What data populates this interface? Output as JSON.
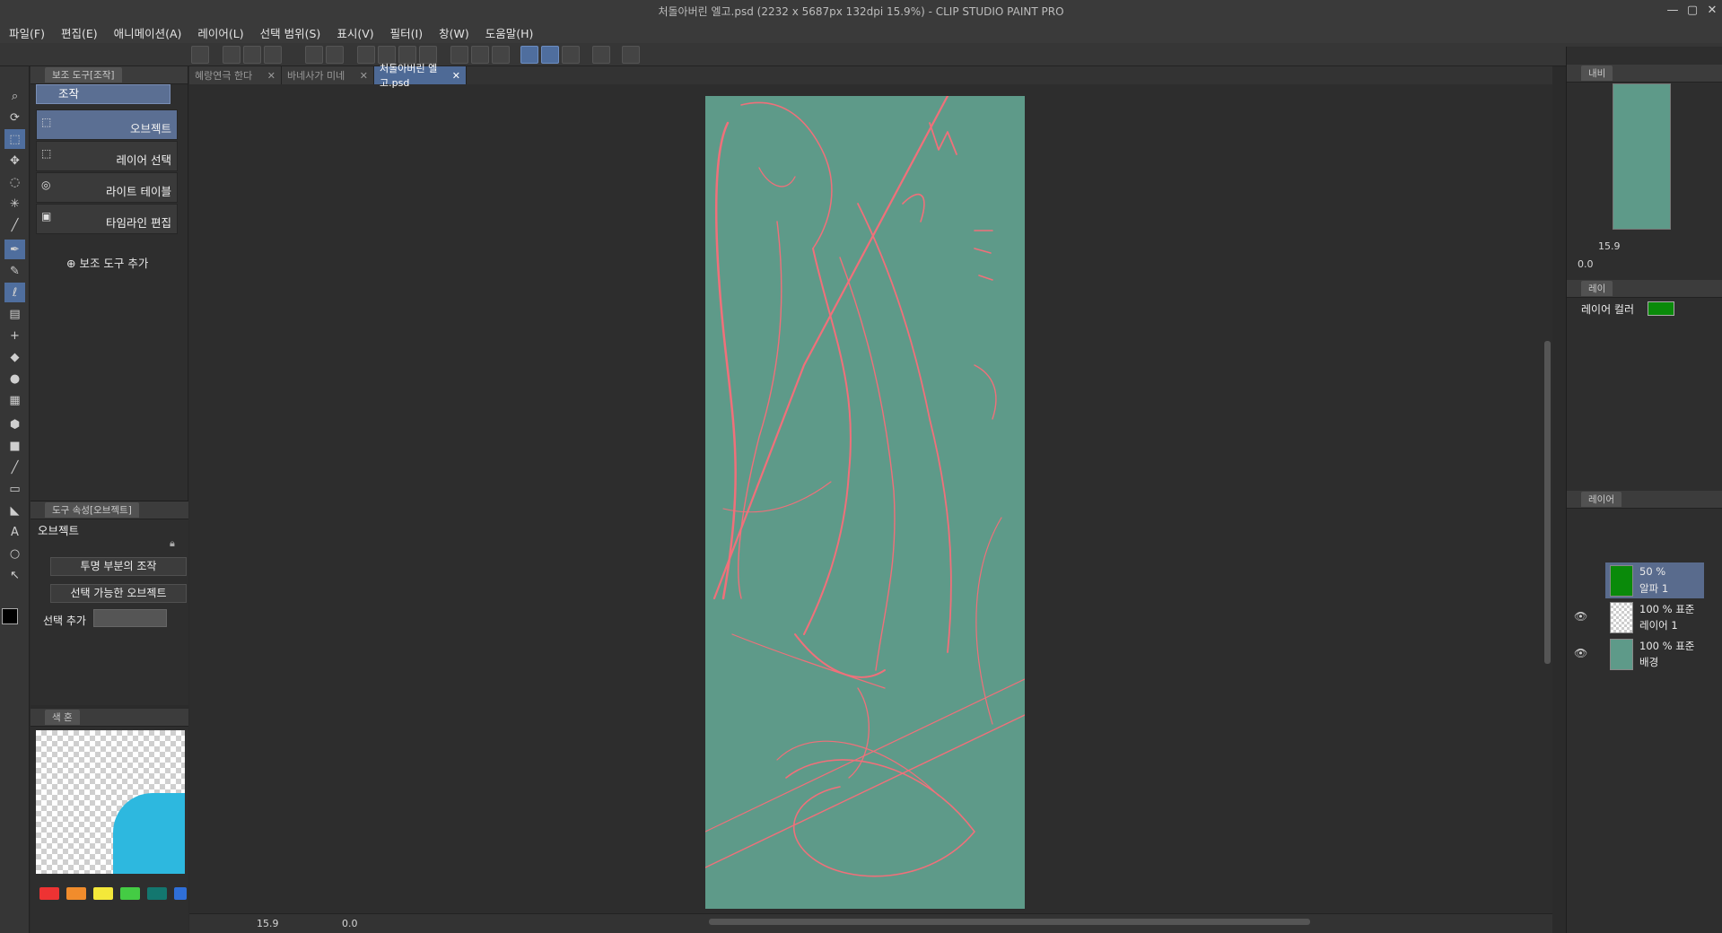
{
  "window": {
    "title": "처돌아버린 엘고.psd (2232 x 5687px 132dpi 15.9%)  - CLIP STUDIO PAINT PRO",
    "controls": [
      "—",
      "▢",
      "✕"
    ]
  },
  "menu": [
    "파일(F)",
    "편집(E)",
    "애니메이션(A)",
    "레이어(L)",
    "선택 범위(S)",
    "표시(V)",
    "필터(I)",
    "창(W)",
    "도움말(H)"
  ],
  "subtool_panel": {
    "title": "보조 도구[조작]",
    "group": "조작",
    "items": [
      {
        "label": "오브젝트",
        "icon": "object-icon",
        "selected": true
      },
      {
        "label": "레이어 선택",
        "icon": "layer-select-icon",
        "selected": false
      },
      {
        "label": "라이트 테이블",
        "icon": "light-table-icon",
        "selected": false
      },
      {
        "label": "타임라인 편집",
        "icon": "timeline-icon",
        "selected": false
      }
    ],
    "add_label": "보조 도구 추가"
  },
  "tool_property": {
    "title": "도구 속성[오브젝트]",
    "heading": "오브젝트",
    "transparent_op": "투명 부분의 조작",
    "selectable": "선택 가능한 오브젝트",
    "add_select_label": "선택 추가"
  },
  "color_panel": {
    "tab": "색 혼",
    "swatches": [
      "#ee3333",
      "#f18c2c",
      "#f4e83a",
      "#44cc44",
      "#13776f",
      "#2f6fd8"
    ]
  },
  "doc_tabs": [
    {
      "label": "혜랑연극 한다",
      "active": false
    },
    {
      "label": "바네사가 미네",
      "active": false
    },
    {
      "label": "처돌아버린 엘고.psd",
      "active": true
    }
  ],
  "status": {
    "zoom": "15.9",
    "angle": "0.0"
  },
  "navigator": {
    "tab": "내비",
    "zoom": "15.9",
    "angle": "0.0"
  },
  "layer_property": {
    "tab": "레이",
    "label": "레이어 컬러",
    "color": "#0a8a0a"
  },
  "layers": {
    "tab": "레이어",
    "rows": [
      {
        "opacity_blend": "50 %",
        "name": "알파 1",
        "selected": true,
        "visible": false
      },
      {
        "opacity_blend": "100 % 표준",
        "name": "레이어 1",
        "selected": false,
        "visible": true
      },
      {
        "opacity_blend": "100 % 표준",
        "name": "배경",
        "selected": false,
        "visible": true
      }
    ]
  },
  "colors": {
    "accent": "#4f6e9e",
    "canvas": "#5e9a89",
    "stroke": "#f0707a"
  }
}
